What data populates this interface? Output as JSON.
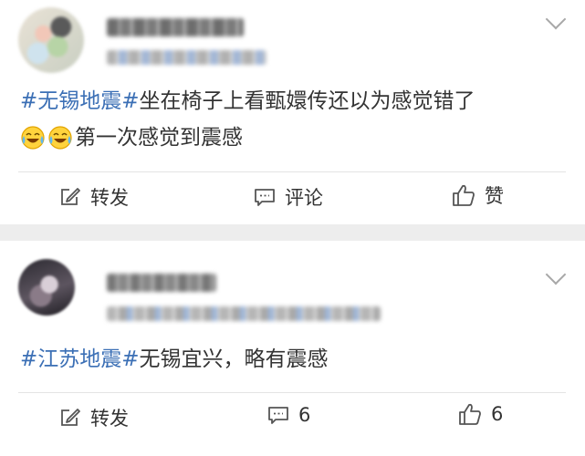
{
  "posts": [
    {
      "text_line1": [
        {
          "text": "#无锡地震#",
          "tag": true
        },
        {
          "text": "坐在椅子上看甄嬛传还以为感觉错了",
          "tag": false
        }
      ],
      "emoji_names": [
        "laughing-crying-emoji",
        "laughing-crying-emoji"
      ],
      "text_line2": "第一次感觉到震感",
      "actions": {
        "repost": "转发",
        "comment": "评论",
        "like": "赞"
      }
    },
    {
      "text_line1": [
        {
          "text": "#江苏地震#",
          "tag": true
        },
        {
          "text": "无锡宜兴，略有震感",
          "tag": false
        }
      ],
      "actions": {
        "repost": "转发",
        "comment": "6",
        "like": "6"
      }
    }
  ],
  "colors": {
    "tag": "#3b6fb5",
    "text": "#333333",
    "background": "#ededed",
    "card": "#ffffff"
  },
  "icons": {
    "repost": "edit-square-icon",
    "comment": "comment-bubble-icon",
    "like": "thumbs-up-icon",
    "menu": "chevron-down-icon"
  }
}
